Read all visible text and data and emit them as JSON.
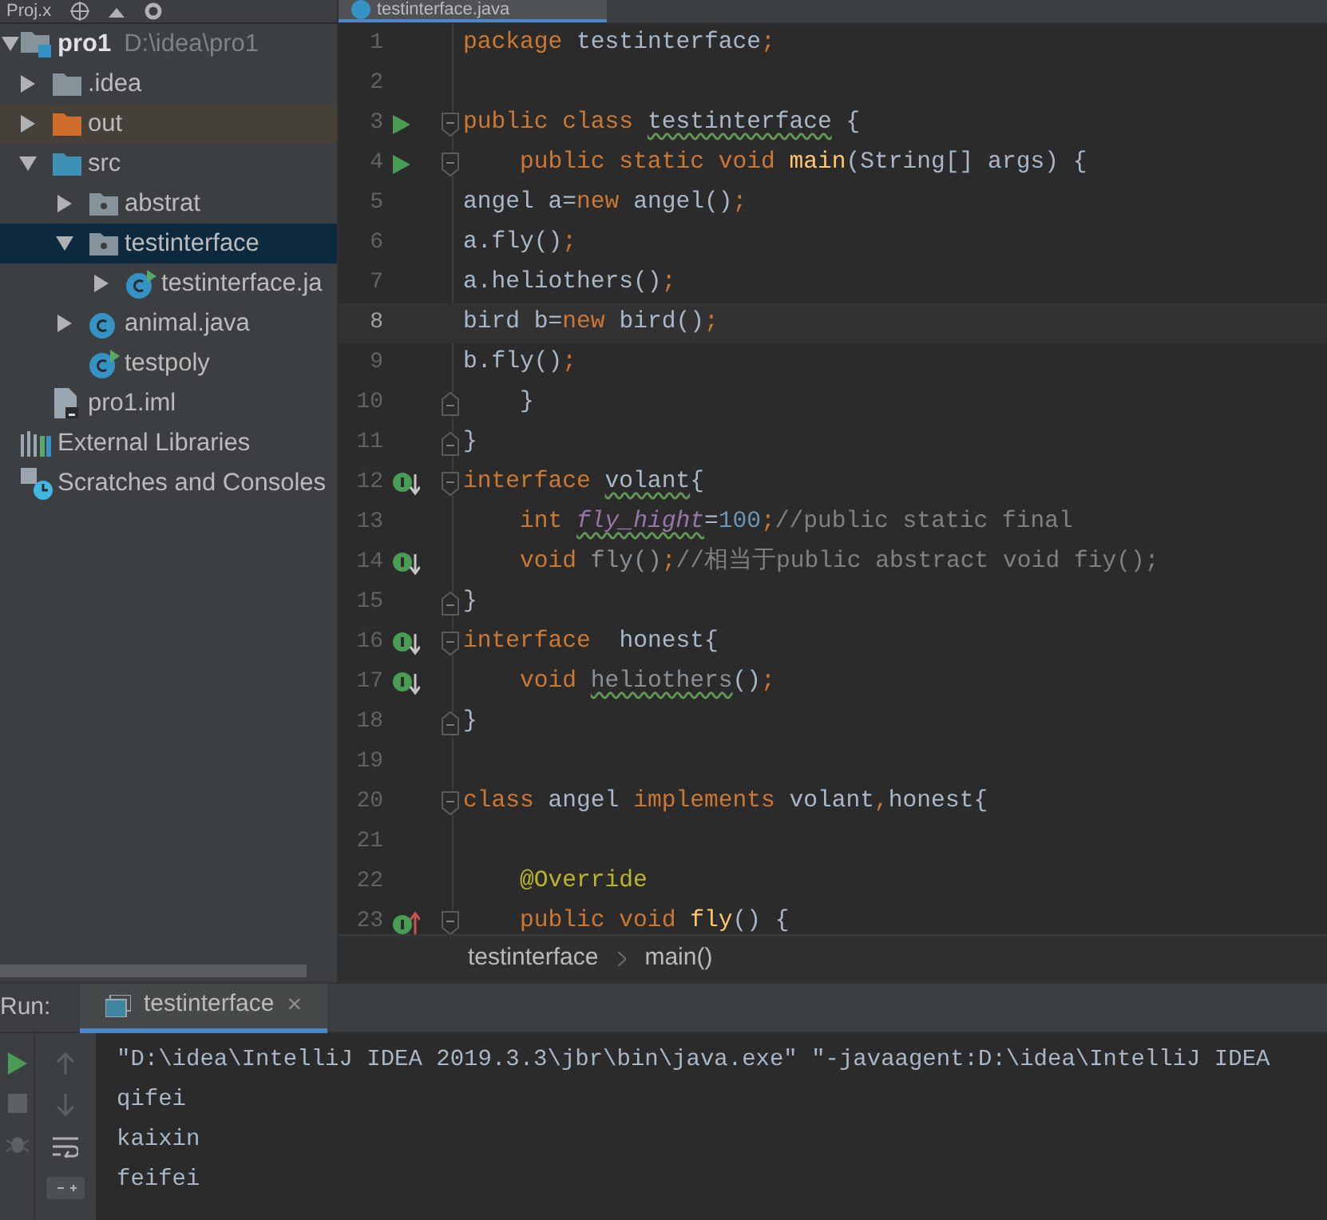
{
  "project_panel": {
    "title": "Proj.x",
    "tree": [
      {
        "label": "pro1",
        "path": "D:\\idea\\pro1",
        "kind": "module",
        "expanded": true,
        "selected": false,
        "children": [
          {
            "label": ".idea",
            "kind": "folder",
            "expanded": false,
            "selected": false
          },
          {
            "label": "out",
            "kind": "excluded-folder",
            "expanded": false,
            "selected": false
          },
          {
            "label": "src",
            "kind": "source-folder",
            "expanded": true,
            "selected": false,
            "children": [
              {
                "label": "abstrat",
                "kind": "package",
                "expanded": false,
                "selected": false
              },
              {
                "label": "testinterface",
                "kind": "package",
                "expanded": true,
                "selected": true,
                "children": [
                  {
                    "label": "testinterface.ja",
                    "kind": "class-run",
                    "expanded": false,
                    "selected": false
                  }
                ]
              },
              {
                "label": "animal.java",
                "kind": "class",
                "expanded": false,
                "selected": false
              },
              {
                "label": "testpoly",
                "kind": "class-run",
                "selected": false
              }
            ]
          },
          {
            "label": "pro1.iml",
            "kind": "iml",
            "selected": false
          }
        ]
      },
      {
        "label": "External Libraries",
        "kind": "libraries",
        "selected": false
      },
      {
        "label": "Scratches and Consoles",
        "kind": "scratches",
        "selected": false
      }
    ]
  },
  "editor": {
    "tab": "testinterface.java",
    "lines": [
      {
        "n": "1",
        "current": false,
        "tokens": [
          {
            "text": "package ",
            "kind": "keyword"
          },
          {
            "text": "testinterface",
            "kind": "plain"
          },
          {
            "text": ";",
            "kind": "keyword"
          }
        ]
      },
      {
        "n": "2",
        "current": false
      },
      {
        "n": "3",
        "current": false,
        "gutter": {
          "kind": "run"
        },
        "fold": {
          "kind": "start"
        },
        "tokens": [
          {
            "text": "public class ",
            "kind": "keyword"
          },
          {
            "text": "testinterface",
            "kind": "plain",
            "underlined": true
          },
          {
            "text": " {",
            "kind": "plain"
          }
        ]
      },
      {
        "n": "4",
        "current": false,
        "gutter": {
          "kind": "run"
        },
        "fold": {
          "kind": "start"
        },
        "tokens": [
          {
            "text": "    public static void ",
            "kind": "keyword"
          },
          {
            "text": "main",
            "kind": "method"
          },
          {
            "text": "(String[] args) {",
            "kind": "plain"
          }
        ]
      },
      {
        "n": "5",
        "current": false,
        "tokens": [
          {
            "text": "angel a=",
            "kind": "plain"
          },
          {
            "text": "new ",
            "kind": "keyword"
          },
          {
            "text": "angel()",
            "kind": "plain"
          },
          {
            "text": ";",
            "kind": "keyword"
          }
        ]
      },
      {
        "n": "6",
        "current": false,
        "tokens": [
          {
            "text": "a.fly()",
            "kind": "plain"
          },
          {
            "text": ";",
            "kind": "keyword"
          }
        ]
      },
      {
        "n": "7",
        "current": false,
        "tokens": [
          {
            "text": "a.heliothers()",
            "kind": "plain"
          },
          {
            "text": ";",
            "kind": "keyword"
          }
        ]
      },
      {
        "n": "8",
        "current": true,
        "tokens": [
          {
            "text": "bird b=",
            "kind": "plain"
          },
          {
            "text": "new ",
            "kind": "keyword"
          },
          {
            "text": "bird()",
            "kind": "plain"
          },
          {
            "text": ";",
            "kind": "keyword"
          }
        ]
      },
      {
        "n": "9",
        "current": false,
        "tokens": [
          {
            "text": "b.fly()",
            "kind": "plain"
          },
          {
            "text": ";",
            "kind": "keyword"
          }
        ]
      },
      {
        "n": "10",
        "current": false,
        "fold": {
          "kind": "end"
        },
        "tokens": [
          {
            "text": "    }",
            "kind": "plain"
          }
        ]
      },
      {
        "n": "11",
        "current": false,
        "fold": {
          "kind": "end"
        },
        "tokens": [
          {
            "text": "}",
            "kind": "plain"
          }
        ]
      },
      {
        "n": "12",
        "current": false,
        "gutter": {
          "kind": "implemented"
        },
        "fold": {
          "kind": "start"
        },
        "tokens": [
          {
            "text": "interface ",
            "kind": "keyword"
          },
          {
            "text": "volant",
            "kind": "plain",
            "underlined": true
          },
          {
            "text": "{",
            "kind": "plain"
          }
        ]
      },
      {
        "n": "13",
        "current": false,
        "tokens": [
          {
            "text": "    int ",
            "kind": "keyword"
          },
          {
            "text": "fly_hight",
            "kind": "field",
            "underlined": true
          },
          {
            "text": "=",
            "kind": "plain"
          },
          {
            "text": "100",
            "kind": "number"
          },
          {
            "text": ";",
            "kind": "keyword"
          },
          {
            "text": "//public static final",
            "kind": "comment"
          }
        ]
      },
      {
        "n": "14",
        "current": false,
        "gutter": {
          "kind": "implemented"
        },
        "tokens": [
          {
            "text": "    void ",
            "kind": "keyword"
          },
          {
            "text": "fly()",
            "kind": "unused"
          },
          {
            "text": ";",
            "kind": "keyword"
          },
          {
            "text": "//相当于public abstract void fiy();",
            "kind": "comment"
          }
        ]
      },
      {
        "n": "15",
        "current": false,
        "fold": {
          "kind": "end"
        },
        "tokens": [
          {
            "text": "}",
            "kind": "plain"
          }
        ]
      },
      {
        "n": "16",
        "current": false,
        "gutter": {
          "kind": "implemented"
        },
        "fold": {
          "kind": "start"
        },
        "tokens": [
          {
            "text": "interface  ",
            "kind": "keyword"
          },
          {
            "text": "honest{",
            "kind": "plain"
          }
        ]
      },
      {
        "n": "17",
        "current": false,
        "gutter": {
          "kind": "implemented"
        },
        "tokens": [
          {
            "text": "    void ",
            "kind": "keyword"
          },
          {
            "text": "heliothers",
            "kind": "unused",
            "underlined": true
          },
          {
            "text": "()",
            "kind": "plain"
          },
          {
            "text": ";",
            "kind": "keyword"
          }
        ]
      },
      {
        "n": "18",
        "current": false,
        "fold": {
          "kind": "end"
        },
        "tokens": [
          {
            "text": "}",
            "kind": "plain"
          }
        ]
      },
      {
        "n": "19",
        "current": false
      },
      {
        "n": "20",
        "current": false,
        "fold": {
          "kind": "start"
        },
        "tokens": [
          {
            "text": "class ",
            "kind": "keyword"
          },
          {
            "text": "angel ",
            "kind": "plain"
          },
          {
            "text": "implements ",
            "kind": "keyword"
          },
          {
            "text": "volant",
            "kind": "plain"
          },
          {
            "text": ",",
            "kind": "keyword"
          },
          {
            "text": "honest{",
            "kind": "plain"
          }
        ]
      },
      {
        "n": "21",
        "current": false
      },
      {
        "n": "22",
        "current": false,
        "tokens": [
          {
            "text": "    @Override",
            "kind": "annotation"
          }
        ]
      },
      {
        "n": "23",
        "current": false,
        "gutter": {
          "kind": "overrides"
        },
        "fold": {
          "kind": "start"
        },
        "tokens": [
          {
            "text": "    public void ",
            "kind": "keyword"
          },
          {
            "text": "fly",
            "kind": "method"
          },
          {
            "text": "() {",
            "kind": "plain"
          }
        ]
      }
    ],
    "breadcrumbs": [
      {
        "label": "testinterface"
      },
      {
        "label": "main()"
      }
    ]
  },
  "run_panel": {
    "label": "Run:",
    "tab": {
      "label": "testinterface",
      "close": "×",
      "selected": true
    },
    "output": [
      "\"D:\\idea\\IntelliJ IDEA 2019.3.3\\jbr\\bin\\java.exe\" \"-javaagent:D:\\idea\\IntelliJ IDEA",
      "qifei",
      "kaixin",
      "feifei"
    ]
  }
}
